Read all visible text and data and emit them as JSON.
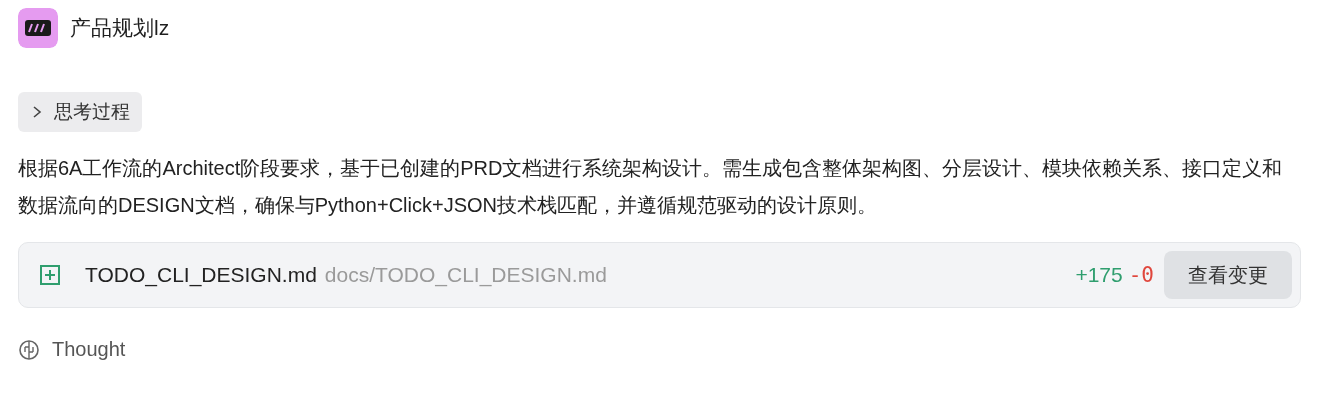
{
  "header": {
    "title": "产品规划lz"
  },
  "thinking_toggle": {
    "label": "思考过程",
    "expanded": false
  },
  "message": "根据6A工作流的Architect阶段要求，基于已创建的PRD文档进行系统架构设计。需生成包含整体架构图、分层设计、模块依赖关系、接口定义和数据流向的DESIGN文档，确保与Python+Click+JSON技术栈匹配，并遵循规范驱动的设计原则。",
  "file_change": {
    "kind": "added",
    "name": "TODO_CLI_DESIGN.md",
    "path": "docs/TODO_CLI_DESIGN.md",
    "additions": "+175",
    "deletions": "-0",
    "button": "查看变更"
  },
  "footer": {
    "label": "Thought"
  }
}
